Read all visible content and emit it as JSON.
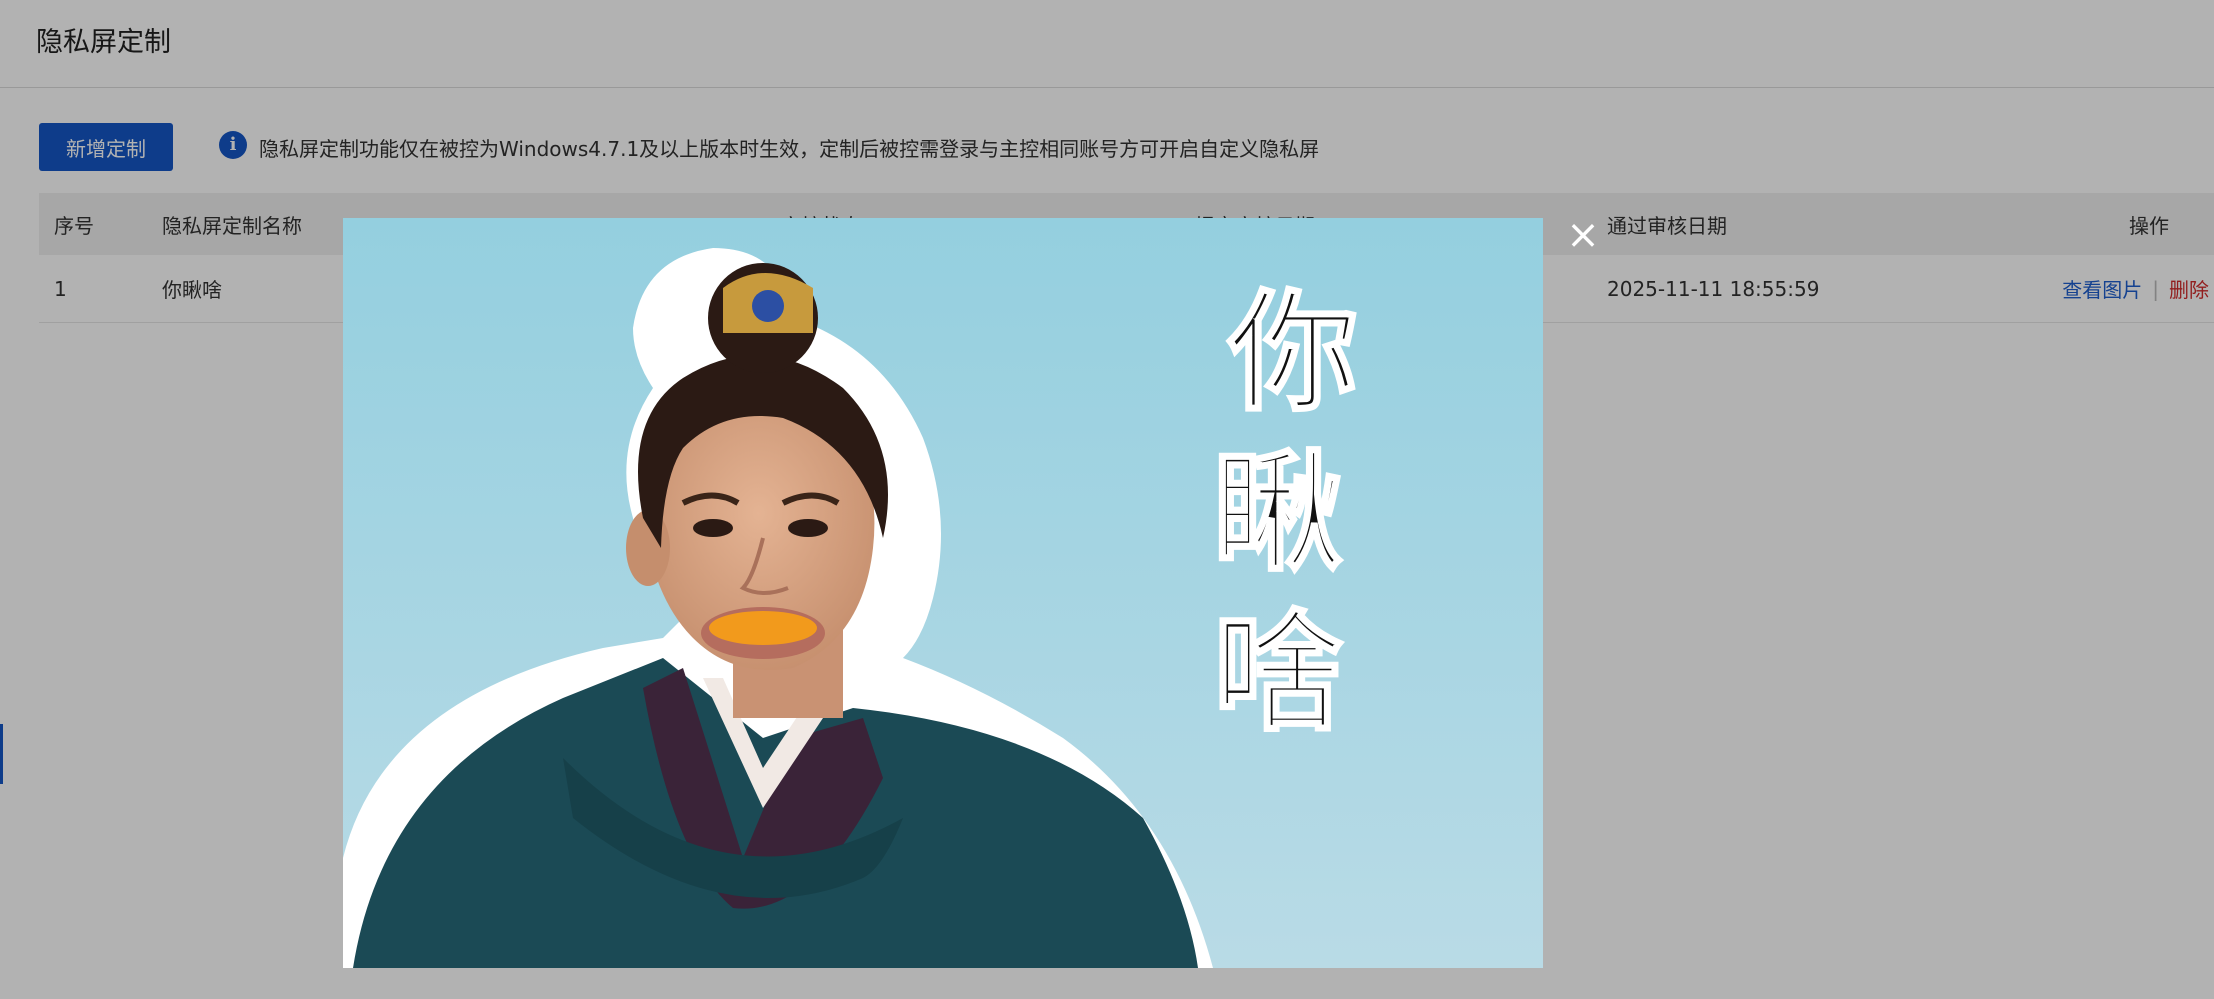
{
  "header": {
    "title": "隐私屏定制"
  },
  "toolbar": {
    "add_label": "新增定制",
    "info_icon": "info-icon",
    "notice": "隐私屏定制功能仅在被控为Windows4.7.1及以上版本时生效，定制后被控需登录与主控相同账号方可开启自定义隐私屏"
  },
  "table": {
    "columns": [
      "序号",
      "隐私屏定制名称",
      "审核状态",
      "提交审核日期",
      "通过审核日期",
      "操作"
    ],
    "rows": [
      {
        "index": "1",
        "name": "你瞅啥",
        "approved_date": "2025-11-11 18:55:59",
        "view_label": "查看图片",
        "delete_label": "删除"
      }
    ]
  },
  "modal": {
    "close_icon": "close-icon",
    "image_caption": [
      "你",
      "瞅",
      "啥"
    ]
  },
  "colors": {
    "primary": "#1557c6",
    "link": "#1f5fcf",
    "danger": "#d12b2b",
    "overlay": "rgba(0,0,0,0.30)"
  }
}
